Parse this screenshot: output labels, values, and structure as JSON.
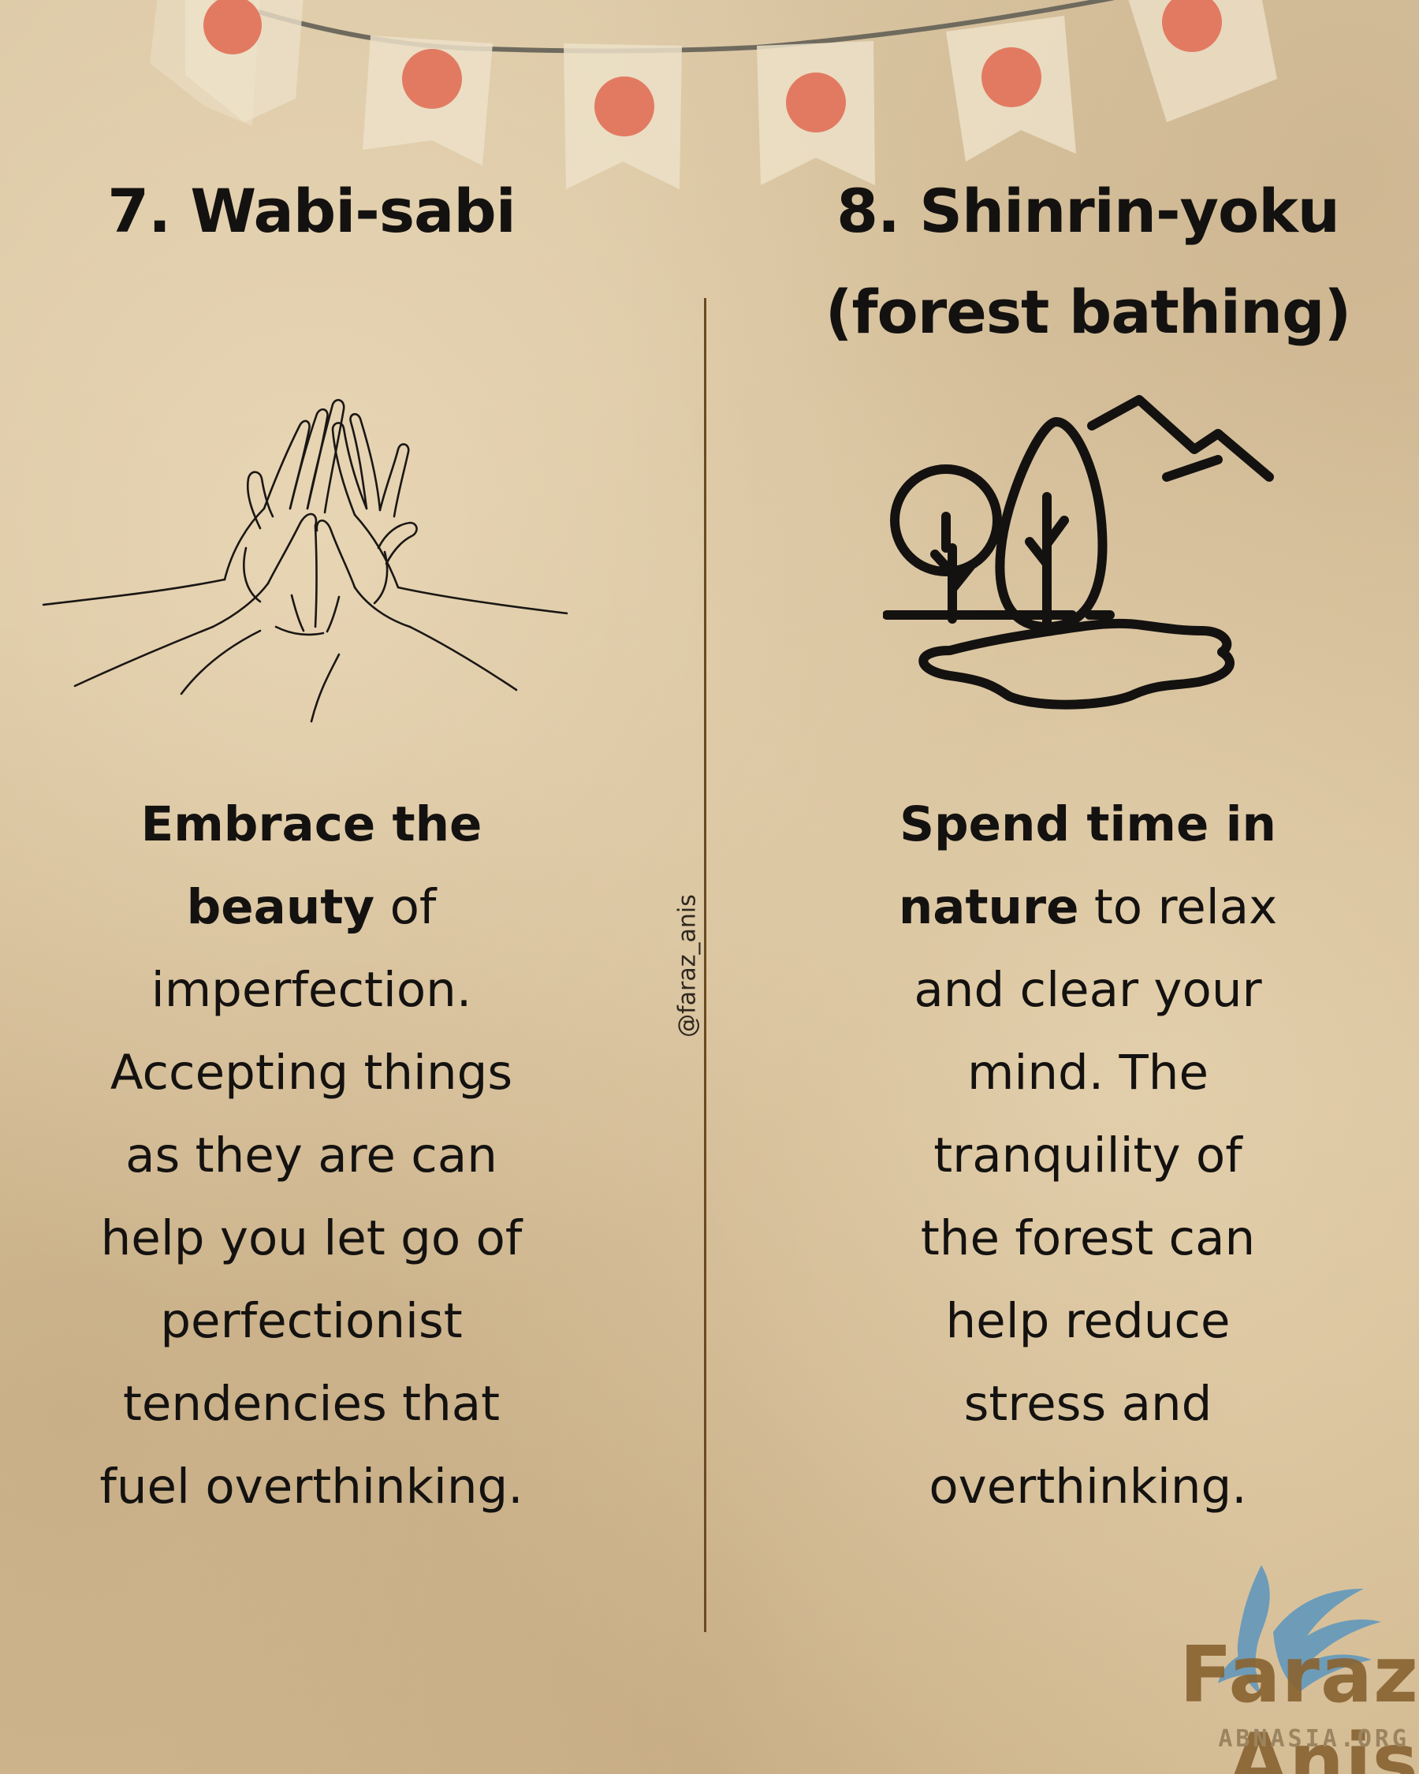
{
  "bunting": {
    "flag_color": "#ece0c8",
    "dot_color": "#e27a62",
    "string_color": "#6f6a5e"
  },
  "left": {
    "title": "7. Wabi-sabi",
    "illustration_icon": "praying-hands-icon",
    "text_bold_1": "Embrace the",
    "text_bold_2": "beauty",
    "text_rest_1": " of",
    "text_rest_2": "imperfection.",
    "text_rest_3": "Accepting things",
    "text_rest_4": "as they are can",
    "text_rest_5": "help you let go of",
    "text_rest_6": "perfectionist",
    "text_rest_7": "tendencies that",
    "text_rest_8": "fuel overthinking."
  },
  "right": {
    "title_line_1": "8. Shinrin-yoku",
    "title_line_2": "(forest bathing)",
    "illustration_icon": "forest-lake-icon",
    "text_bold_1": "Spend time in",
    "text_bold_2": "nature",
    "text_rest_1": " to relax",
    "text_rest_2": "and clear your",
    "text_rest_3": "mind. The",
    "text_rest_4": "tranquility of",
    "text_rest_5": "the forest can",
    "text_rest_6": "help reduce",
    "text_rest_7": "stress and",
    "text_rest_8": "overthinking."
  },
  "divider": {
    "handle": "@faraz_anis",
    "color": "#6a4a22"
  },
  "logo": {
    "name": "Faraz Anis",
    "site": "ABNASIA.ORG",
    "name_color": "#8a6433",
    "bird_color": "#5b95be"
  }
}
